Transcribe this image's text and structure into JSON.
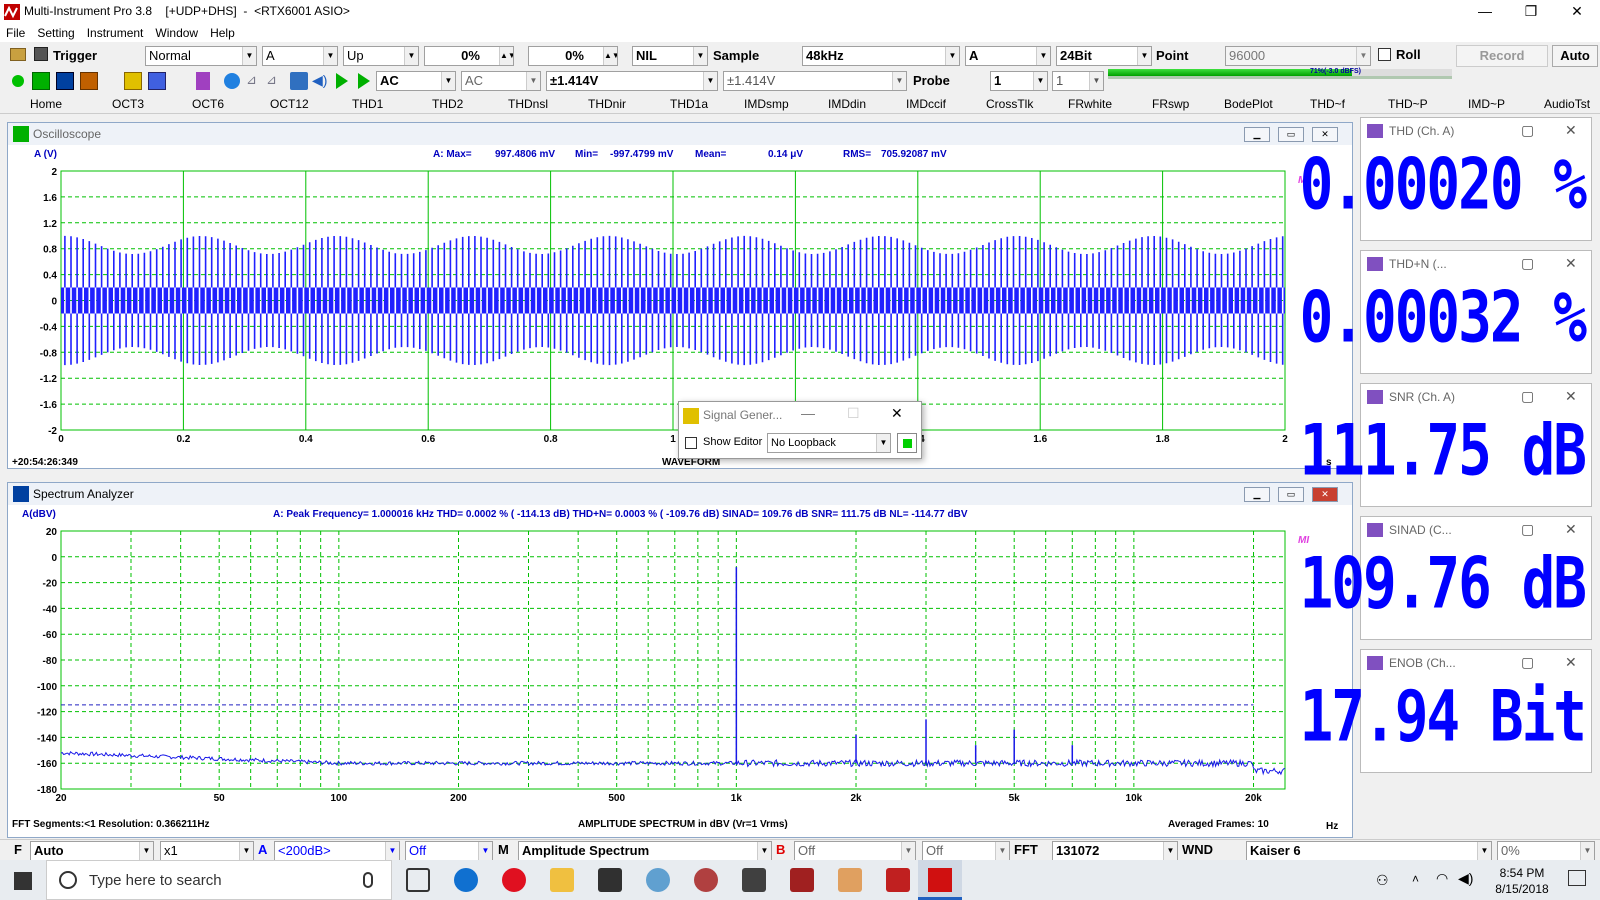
{
  "app": {
    "title": "Multi-Instrument Pro 3.8    [+UDP+DHS]  -  <RTX6001 ASIO>",
    "minimize_glyph": "—",
    "maximize_glyph": "❐",
    "close_glyph": "✕"
  },
  "menu": [
    "File",
    "Setting",
    "Instrument",
    "Window",
    "Help"
  ],
  "toolbar1": {
    "trigger_label": "Trigger",
    "mode": "Normal",
    "channel": "A",
    "edge": "Up",
    "pre_trigger": "0%",
    "level": "0%",
    "nil": "NIL",
    "sample_label": "Sample",
    "sample_rate": "48kHz",
    "ch": "A",
    "bits": "24Bit",
    "point_label": "Point",
    "points": "96000",
    "roll_label": "Roll",
    "record_label": "Record",
    "auto_label": "Auto"
  },
  "toolbar2": {
    "coupling_a": "AC",
    "coupling_b": "AC",
    "range_a": "±1.414V",
    "range_b": "±1.414V",
    "probe_label": "Probe",
    "probe_a": "1",
    "probe_b": "1",
    "level_meter": "71%(-3.0 dBFS)",
    "level_fraction": 0.71
  },
  "tabs": [
    "Home",
    "OCT3",
    "OCT6",
    "OCT12",
    "THD1",
    "THD2",
    "THDnsl",
    "THDnir",
    "THD1a",
    "IMDsmp",
    "IMDdin",
    "IMDccif",
    "CrossTlk",
    "FRwhite",
    "FRswp",
    "BodePlot",
    "THD~f",
    "THD~P",
    "IMD~P",
    "AudioTst"
  ],
  "oscilloscope": {
    "title": "Oscilloscope",
    "ylabel": "A (V)",
    "stats": {
      "max_label": "A: Max=",
      "max": "997.4806 mV",
      "min_label": "Min=",
      "min": "-997.4799 mV",
      "mean_label": "Mean=",
      "mean": "0.14  μV",
      "rms_label": "RMS=",
      "rms": "705.92087 mV"
    },
    "timestamp": "+20:54:26:349",
    "xunit": "s",
    "xtitle": "WAVEFORM",
    "logo": "MI"
  },
  "spectrum": {
    "title": "Spectrum Analyzer",
    "ylabel": "A(dBV)",
    "stats": "A: Peak Frequency=  1.000016  kHz THD=   0.0002 % ( -114.13 dB)  THD+N=   0.0003 % ( -109.76 dB)  SINAD=  109.76 dB  SNR=  111.75 dB  NL= -114.77 dBV",
    "footer_left": "FFT Segments:<1     Resolution: 0.366211Hz",
    "footer_center": "AMPLITUDE SPECTRUM in dBV (Vr=1 Vrms)",
    "footer_right": "Averaged Frames: 10",
    "xunit": "Hz",
    "logo": "MI"
  },
  "chart_data": [
    {
      "type": "line",
      "title": "WAVEFORM",
      "ylabel": "A (V)",
      "xlabel": "s",
      "xlim": [
        0,
        2
      ],
      "ylim": [
        -2,
        2
      ],
      "x_ticks": [
        "0",
        "0.2",
        "0.4",
        "0.6",
        "0.8",
        "1",
        "1.2",
        "1.4",
        "1.6",
        "1.8",
        "2"
      ],
      "y_ticks": [
        "2",
        "1.6",
        "1.2",
        "0.8",
        "0.4",
        "0",
        "-0.4",
        "-0.8",
        "-1.2",
        "-1.6",
        "-2"
      ],
      "series": [
        {
          "amplitude_peak": 0.997,
          "rms": 0.706
        }
      ],
      "grid": true
    },
    {
      "type": "line",
      "title": "AMPLITUDE SPECTRUM in dBV (Vr=1 Vrms)",
      "ylabel": "A(dBV)",
      "xlabel": "Hz",
      "xscale": "log",
      "xlim": [
        20,
        24000
      ],
      "ylim": [
        -180,
        20
      ],
      "x_ticks": [
        {
          "v": 20,
          "t": "20"
        },
        {
          "v": 50,
          "t": "50"
        },
        {
          "v": 100,
          "t": "100"
        },
        {
          "v": 200,
          "t": "200"
        },
        {
          "v": 500,
          "t": "500"
        },
        {
          "v": 1000,
          "t": "1k"
        },
        {
          "v": 2000,
          "t": "2k"
        },
        {
          "v": 5000,
          "t": "5k"
        },
        {
          "v": 10000,
          "t": "10k"
        },
        {
          "v": 20000,
          "t": "20k"
        }
      ],
      "y_ticks": [
        20,
        0,
        -20,
        -40,
        -60,
        -80,
        -100,
        -120,
        -140,
        -160,
        -180
      ],
      "noise_level_line": -114.77,
      "peaks": [
        {
          "f": 1000,
          "db": -8
        },
        {
          "f": 2000,
          "db": -138
        },
        {
          "f": 3000,
          "db": -126
        },
        {
          "f": 4000,
          "db": -146
        },
        {
          "f": 5000,
          "db": -134
        },
        {
          "f": 7000,
          "db": -146
        }
      ],
      "noise_floor_db": -160,
      "grid": true
    }
  ],
  "meters": [
    {
      "title": "THD (Ch. A)",
      "value": "0.00020 %"
    },
    {
      "title": "THD+N (...",
      "value": "0.00032 %"
    },
    {
      "title": "SNR (Ch. A)",
      "value": "111.75 dB"
    },
    {
      "title": "SINAD (C...",
      "value": "109.76 dB"
    },
    {
      "title": "ENOB (Ch...",
      "value": "17.94 Bit"
    }
  ],
  "siggen": {
    "title": "Signal Gener...",
    "show_editor": "Show Editor",
    "loopback": "No Loopback"
  },
  "bottombar": {
    "f_label": "F",
    "f_mode": "Auto",
    "mult": "x1",
    "a_label": "A",
    "a_range": "<200dB>",
    "a_off": "Off",
    "m_label": "M",
    "m_mode": "Amplitude Spectrum",
    "b_label": "B",
    "b_off1": "Off",
    "b_off2": "Off",
    "fft_label": "FFT",
    "fft_size": "131072",
    "wnd_label": "WND",
    "wnd": "Kaiser 6",
    "overlap": "0%"
  },
  "taskbar": {
    "search": "Type here to search",
    "time": "8:54 PM",
    "date": "8/15/2018"
  }
}
